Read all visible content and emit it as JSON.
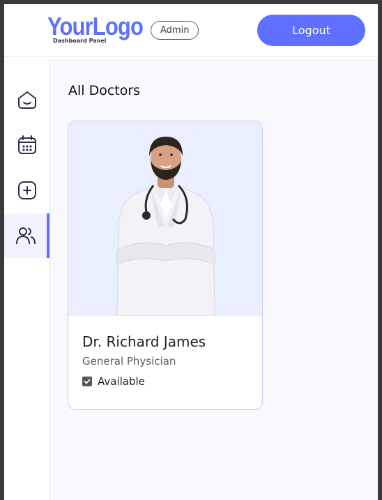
{
  "header": {
    "logo_main": "YourLogo",
    "logo_sub": "Dashboard Panel",
    "role_badge": "Admin",
    "logout_label": "Logout"
  },
  "sidebar": {
    "items": [
      {
        "name": "home",
        "icon": "home-icon",
        "active": false
      },
      {
        "name": "appointments",
        "icon": "calendar-icon",
        "active": false
      },
      {
        "name": "add-doctor",
        "icon": "add-icon",
        "active": false
      },
      {
        "name": "doctors-list",
        "icon": "people-icon",
        "active": true
      }
    ]
  },
  "main": {
    "title": "All Doctors",
    "doctors": [
      {
        "name": "Dr. Richard James",
        "speciality": "General Physician",
        "available": true,
        "available_label": "Available",
        "photo_icon": "doctor-photo"
      }
    ]
  },
  "colors": {
    "primary": "#5f6fff",
    "photo_bg": "#eaefff",
    "card_border": "#c9cdf5",
    "main_bg": "#f8f9fd"
  }
}
